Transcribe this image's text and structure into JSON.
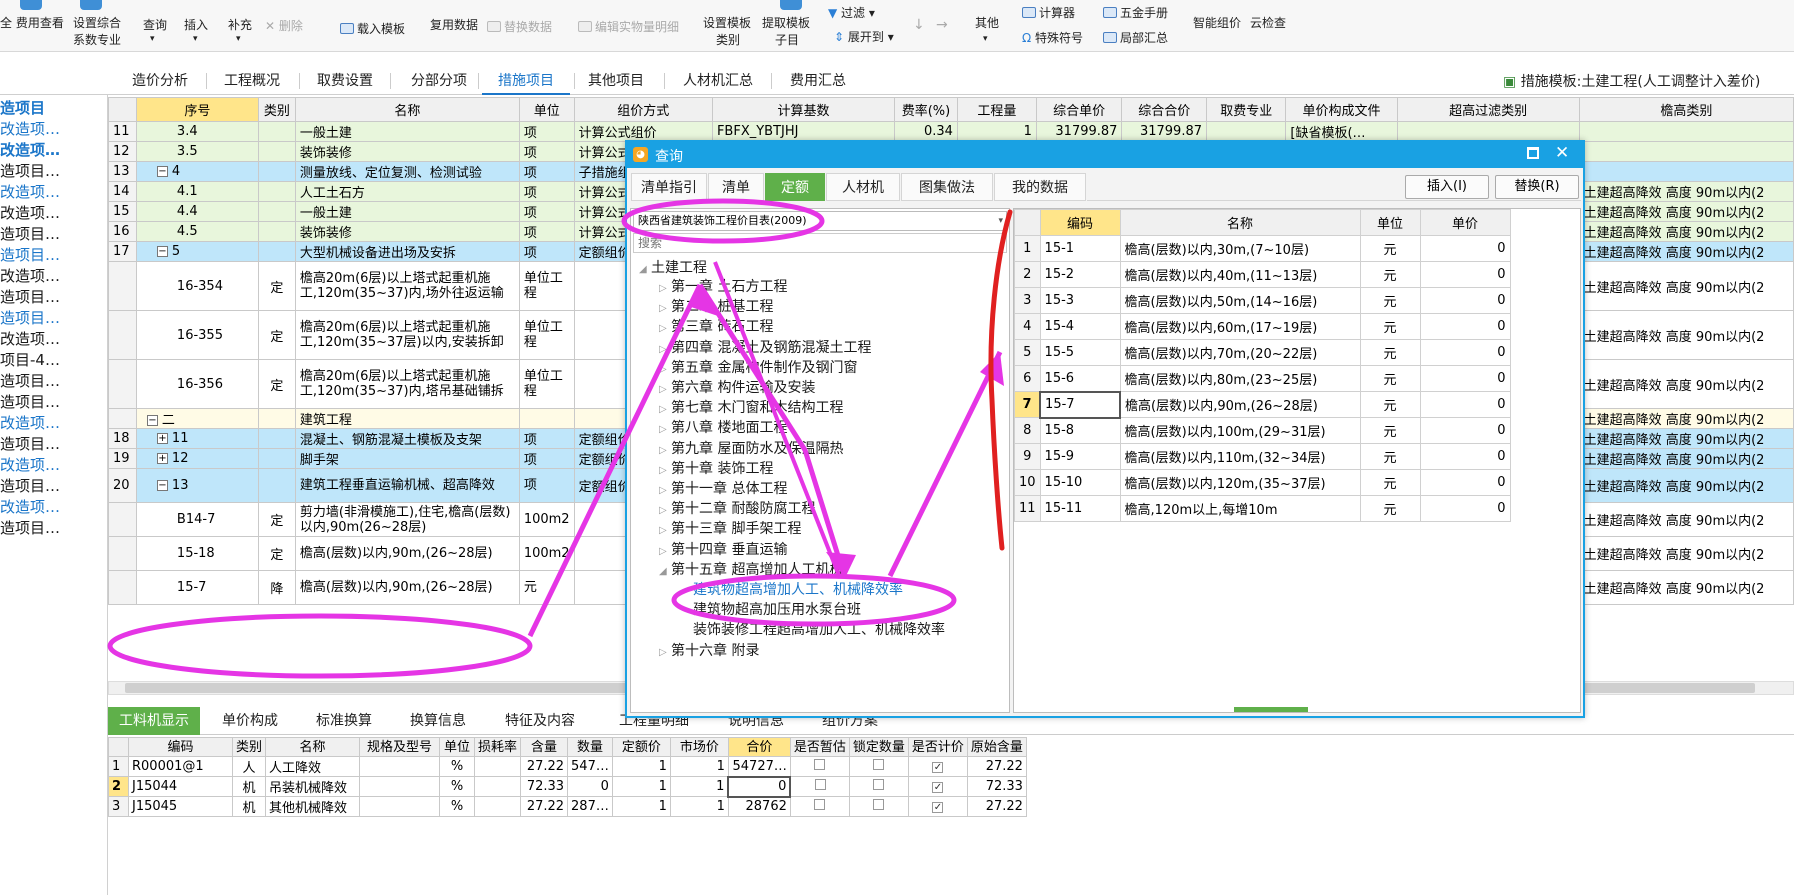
{
  "ribbon": {
    "items": [
      "费用查看",
      "设置综合",
      "系数专业",
      "查询",
      "插入",
      "补充",
      "删除",
      "载入模板",
      "复用数据",
      "替换数据",
      "编辑实物量明细",
      "设置模板",
      "类别",
      "提取模板",
      "子目",
      "过滤",
      "展开到",
      "其他",
      "计算器",
      "特殊符号",
      "五金手册",
      "局部汇总",
      "智能组价",
      "云检查"
    ]
  },
  "left_toolbar": {
    "collapse": "«"
  },
  "main_tabs": [
    "造价分析",
    "工程概况",
    "取费设置",
    "分部分项",
    "措施项目",
    "其他项目",
    "人材机汇总",
    "费用汇总"
  ],
  "active_main_tab": "措施项目",
  "template_label": "措施模板:土建工程(人工调整计入差价)",
  "left_tree": [
    "造项目",
    "改造项…",
    "改造项…",
    "造项目…",
    "改造项…",
    "改造项…",
    "造项目…",
    "造项目…",
    "改造项…",
    "造项目…",
    "造项目…",
    "改造项…",
    "项目-4…",
    "造项目…",
    "造项目…",
    "改造项…",
    "造项目…",
    "改造项…",
    "造项目…",
    "改造项…",
    "造项目…"
  ],
  "grid": {
    "headers": [
      "序号",
      "类别",
      "名称",
      "单位",
      "组价方式",
      "计算基数",
      "费率(%)",
      "工程量",
      "综合单价",
      "综合合价",
      "取费专业",
      "单价构成文件",
      "超高过滤类别",
      "檐高类别"
    ],
    "rows": [
      {
        "rn": "11",
        "seq": "3.4",
        "cat": "",
        "name": "一般土建",
        "unit": "项",
        "method": "计算公式组价",
        "base": "FBFX_YBTJHJ",
        "rate": "0.34",
        "qty": "1",
        "uprice": "31799.87",
        "total": "31799.87",
        "fee": "",
        "file": "[缺省模板(…",
        "filter": "",
        "eaves": ""
      },
      {
        "rn": "12",
        "seq": "3.5",
        "cat": "",
        "name": "装饰装修",
        "unit": "项",
        "method": "计算公式组价",
        "base": "",
        "rate": "",
        "qty": "",
        "uprice": "",
        "total": "",
        "fee": "",
        "file": "",
        "filter": "",
        "eaves": ""
      },
      {
        "rn": "13",
        "seq": "4",
        "cat": "",
        "name": "测量放线、定位复测、检测试验",
        "unit": "项",
        "method": "子措施组价",
        "base": "",
        "rate": "",
        "qty": "",
        "uprice": "",
        "total": "",
        "fee": "",
        "file": "",
        "filter": "",
        "eaves": ""
      },
      {
        "rn": "14",
        "seq": "4.1",
        "cat": "",
        "name": "人工土石方",
        "unit": "项",
        "method": "计算公式组价",
        "base": "",
        "rate": "",
        "qty": "",
        "uprice": "",
        "total": "",
        "fee": "",
        "file": "",
        "filter": "",
        "eaves": "土建超高降效 高度 90m以内(2"
      },
      {
        "rn": "15",
        "seq": "4.4",
        "cat": "",
        "name": "一般土建",
        "unit": "项",
        "method": "计算公式组价",
        "base": "",
        "rate": "",
        "qty": "",
        "uprice": "",
        "total": "",
        "fee": "",
        "file": "",
        "filter": "",
        "eaves": "土建超高降效 高度 90m以内(2"
      },
      {
        "rn": "16",
        "seq": "4.5",
        "cat": "",
        "name": "装饰装修",
        "unit": "项",
        "method": "计算公式组价",
        "base": "",
        "rate": "",
        "qty": "",
        "uprice": "",
        "total": "",
        "fee": "",
        "file": "",
        "filter": "",
        "eaves": "土建超高降效 高度 90m以内(2"
      },
      {
        "rn": "17",
        "seq": "5",
        "cat": "",
        "name": "大型机械设备进出场及安拆",
        "unit": "项",
        "method": "定额组价",
        "base": "",
        "rate": "",
        "qty": "",
        "uprice": "",
        "total": "",
        "fee": "",
        "file": "",
        "filter": "",
        "eaves": "土建超高降效 高度 90m以内(2"
      },
      {
        "rn": "",
        "seq": "16-354",
        "cat": "定",
        "name": "檐高20m(6层)以上塔式起重机施工,120m(35~37)内,场外往返运输",
        "unit": "单位工程",
        "method": "",
        "base": "",
        "rate": "",
        "qty": "",
        "uprice": "",
        "total": "",
        "fee": "",
        "file": "",
        "filter": "",
        "eaves": "土建超高降效 高度 90m以内(2"
      },
      {
        "rn": "",
        "seq": "16-355",
        "cat": "定",
        "name": "檐高20m(6层)以上塔式起重机施工,120m(35~37层)以内,安装拆卸",
        "unit": "单位工程",
        "method": "",
        "base": "",
        "rate": "",
        "qty": "",
        "uprice": "",
        "total": "",
        "fee": "",
        "file": "",
        "filter": "",
        "eaves": "土建超高降效 高度 90m以内(2"
      },
      {
        "rn": "",
        "seq": "16-356",
        "cat": "定",
        "name": "檐高20m(6层)以上塔式起重机施工,120m(35~37)内,塔吊基础铺拆",
        "unit": "单位工程",
        "method": "",
        "base": "",
        "rate": "",
        "qty": "",
        "uprice": "",
        "total": "",
        "fee": "",
        "file": "",
        "filter": "",
        "eaves": "土建超高降效 高度 90m以内(2"
      },
      {
        "rn": "",
        "seq": "二",
        "cat": "",
        "name": "建筑工程",
        "unit": "",
        "method": "",
        "base": "",
        "rate": "",
        "qty": "",
        "uprice": "",
        "total": "",
        "fee": "",
        "file": "",
        "filter": "",
        "eaves": "土建超高降效 高度 90m以内(2"
      },
      {
        "rn": "18",
        "seq": "11",
        "cat": "",
        "name": "混凝土、钢筋混凝土模板及支架",
        "unit": "项",
        "method": "定额组价",
        "base": "",
        "rate": "",
        "qty": "",
        "uprice": "",
        "total": "",
        "fee": "",
        "file": "",
        "filter": "",
        "eaves": "土建超高降效 高度 90m以内(2"
      },
      {
        "rn": "19",
        "seq": "12",
        "cat": "",
        "name": "脚手架",
        "unit": "项",
        "method": "定额组价",
        "base": "",
        "rate": "",
        "qty": "",
        "uprice": "",
        "total": "",
        "fee": "",
        "file": "",
        "filter": "",
        "eaves": "土建超高降效 高度 90m以内(2"
      },
      {
        "rn": "20",
        "seq": "13",
        "cat": "",
        "name": "建筑工程垂直运输机械、超高降效",
        "unit": "项",
        "method": "定额组价",
        "base": "",
        "rate": "",
        "qty": "",
        "uprice": "",
        "total": "",
        "fee": "",
        "file": "",
        "filter": "",
        "eaves": "土建超高降效 高度 90m以内(2"
      },
      {
        "rn": "",
        "seq": "B14-7",
        "cat": "定",
        "name": "剪力墙(非滑模施工),住宅,檐高(层数)以内,90m(26~28层)",
        "unit": "100m2",
        "method": "",
        "base": "",
        "rate": "",
        "qty": "",
        "uprice": "",
        "total": "",
        "fee": "",
        "file": "",
        "filter": "",
        "eaves": "土建超高降效 高度 90m以内(2"
      },
      {
        "rn": "",
        "seq": "15-18",
        "cat": "定",
        "name": "檐高(层数)以内,90m,(26~28层)",
        "unit": "100m2",
        "method": "",
        "base": "",
        "rate": "",
        "qty": "",
        "uprice": "",
        "total": "",
        "fee": "",
        "file": "",
        "filter": "",
        "eaves": "土建超高降效 高度 90m以内(2"
      },
      {
        "rn": "",
        "seq": "15-7",
        "cat": "降",
        "name": "檐高(层数)以内,90m,(26~28层)",
        "unit": "元",
        "method": "",
        "base": "",
        "rate": "",
        "qty": "",
        "uprice": "",
        "total": "",
        "fee": "",
        "file": "",
        "filter": "",
        "eaves": "土建超高降效 高度 90m以内(2"
      }
    ]
  },
  "bottom_tabs": [
    "工料机显示",
    "单价构成",
    "标准换算",
    "换算信息",
    "特征及内容",
    "工程量明细",
    "说明信息",
    "组价方案"
  ],
  "bottom_grid": {
    "headers": [
      "编码",
      "类别",
      "名称",
      "规格及型号",
      "单位",
      "损耗率",
      "含量",
      "数量",
      "定额价",
      "市场价",
      "合价",
      "是否暂估",
      "锁定数量",
      "是否计价",
      "原始含量"
    ],
    "rows": [
      {
        "rn": "1",
        "code": "R00001@1",
        "cat": "人",
        "name": "人工降效",
        "spec": "",
        "unit": "%",
        "loss": "",
        "content": "27.22",
        "qty": "547…",
        "dprice": "1",
        "mprice": "1",
        "total": "54727…",
        "orig": "27.22"
      },
      {
        "rn": "2",
        "code": "J15044",
        "cat": "机",
        "name": "吊装机械降效",
        "spec": "",
        "unit": "%",
        "loss": "",
        "content": "72.33",
        "qty": "0",
        "dprice": "1",
        "mprice": "1",
        "total": "0",
        "orig": "72.33"
      },
      {
        "rn": "3",
        "code": "J15045",
        "cat": "机",
        "name": "其他机械降效",
        "spec": "",
        "unit": "%",
        "loss": "",
        "content": "27.22",
        "qty": "287…",
        "dprice": "1",
        "mprice": "1",
        "total": "28762",
        "orig": "27.22"
      }
    ]
  },
  "dialog": {
    "title": "查询",
    "tabs": [
      "清单指引",
      "清单",
      "定额",
      "人材机",
      "图集做法",
      "我的数据"
    ],
    "active_tab": "定额",
    "insert_btn": "插入(I)",
    "replace_btn": "替换(R)",
    "library": "陕西省建筑装饰工程价目表(2009)",
    "search_placeholder": "搜索",
    "tree": {
      "root": "土建工程",
      "chapters": [
        "第一章 土石方工程",
        "第二章 桩基工程",
        "第三章 砖石工程",
        "第四章 混凝土及钢筋混凝土工程",
        "第五章 金属构件制作及钢门窗",
        "第六章 构件运输及安装",
        "第七章 木门窗和木结构工程",
        "第八章 楼地面工程",
        "第九章 屋面防水及保温隔热",
        "第十章 装饰工程",
        "第十一章 总体工程",
        "第十二章 耐酸防腐工程",
        "第十三章 脚手架工程",
        "第十四章 垂直运输",
        "第十五章 超高增加人工机械"
      ],
      "children": [
        "建筑物超高增加人工、机械降效率",
        "建筑物超高加压用水泵台班",
        "装饰装修工程超高增加人工、机械降效率"
      ],
      "last": "第十六章 附录"
    },
    "grid": {
      "headers": [
        "编码",
        "名称",
        "单位",
        "单价"
      ],
      "rows": [
        {
          "rn": "1",
          "code": "15-1",
          "name": "檐高(层数)以内,30m,(7~10层)",
          "unit": "元",
          "price": "0"
        },
        {
          "rn": "2",
          "code": "15-2",
          "name": "檐高(层数)以内,40m,(11~13层)",
          "unit": "元",
          "price": "0"
        },
        {
          "rn": "3",
          "code": "15-3",
          "name": "檐高(层数)以内,50m,(14~16层)",
          "unit": "元",
          "price": "0"
        },
        {
          "rn": "4",
          "code": "15-4",
          "name": "檐高(层数)以内,60m,(17~19层)",
          "unit": "元",
          "price": "0"
        },
        {
          "rn": "5",
          "code": "15-5",
          "name": "檐高(层数)以内,70m,(20~22层)",
          "unit": "元",
          "price": "0"
        },
        {
          "rn": "6",
          "code": "15-6",
          "name": "檐高(层数)以内,80m,(23~25层)",
          "unit": "元",
          "price": "0"
        },
        {
          "rn": "7",
          "code": "15-7",
          "name": "檐高(层数)以内,90m,(26~28层)",
          "unit": "元",
          "price": "0"
        },
        {
          "rn": "8",
          "code": "15-8",
          "name": "檐高(层数)以内,100m,(29~31层)",
          "unit": "元",
          "price": "0"
        },
        {
          "rn": "9",
          "code": "15-9",
          "name": "檐高(层数)以内,110m,(32~34层)",
          "unit": "元",
          "price": "0"
        },
        {
          "rn": "10",
          "code": "15-10",
          "name": "檐高(层数)以内,120m,(35~37层)",
          "unit": "元",
          "price": "0"
        },
        {
          "rn": "11",
          "code": "15-11",
          "name": "檐高,120m以上,每增10m",
          "unit": "元",
          "price": "0"
        }
      ]
    }
  },
  "colors": {
    "accent": "#19a1e3",
    "active_tab": "#5fb04a",
    "highlight": "#ffe58a",
    "annotation": "#e535e5",
    "annotation_red": "#e02020"
  }
}
